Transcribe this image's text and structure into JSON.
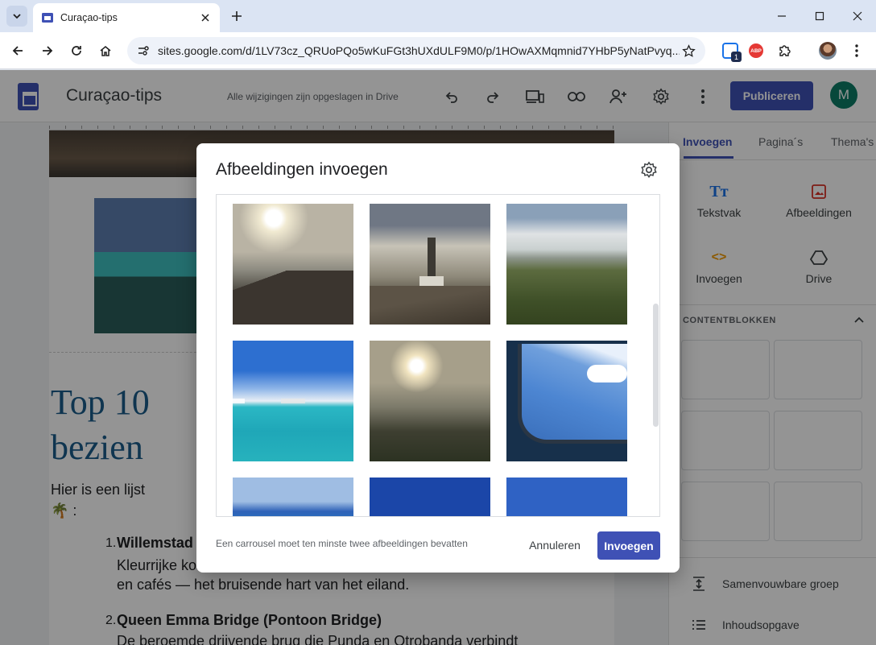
{
  "browser": {
    "tab_title": "Curaçao-tips",
    "url": "sites.google.com/d/1LV73cz_QRUoPQo5wKuFGt3hUXdULF9M0/p/1HOwAXMqmnid7YHbP5yNatPvyq...",
    "extension_badge_count": "1",
    "abp_label": "ABP"
  },
  "editor": {
    "site_title": "Curaçao-tips",
    "save_status": "Alle wijzigingen zijn opgeslagen in Drive",
    "publish_label": "Publiceren",
    "avatar_letter": "M",
    "heading_line1": "Top 10",
    "heading_line2": "bezien",
    "intro_line1": "Hier is een lijst",
    "intro_line2": "🌴 :",
    "item1_num": "1.",
    "item1_title": "Willemstad",
    "item1_line1": "Kleurrijke ko",
    "item1_line2": "en cafés — het bruisende hart van het eiland.",
    "item2_num": "2.",
    "item2_title": "Queen Emma Bridge (Pontoon Bridge)",
    "item2_line1": "De beroemde drijvende brug die Punda en Otrobanda verbindt"
  },
  "side_panel": {
    "tabs": [
      "Invoegen",
      "Pagina´s",
      "Thema's"
    ],
    "insert_items": [
      "Tekstvak",
      "Afbeeldingen",
      "Invoegen",
      "Drive"
    ],
    "section_title": "CONTENTBLOKKEN",
    "rows": [
      "Samenvouwbare groep",
      "Inhoudsopgave"
    ]
  },
  "dialog": {
    "title": "Afbeeldingen invoegen",
    "hint": "Een carrousel moet ten minste twee afbeeldingen bevatten",
    "cancel_label": "Annuleren",
    "insert_label": "Invoegen"
  },
  "colors": {
    "accent": "#3f51b5",
    "avatar_bg": "#0d7c66",
    "heading": "#1a5c8a"
  }
}
